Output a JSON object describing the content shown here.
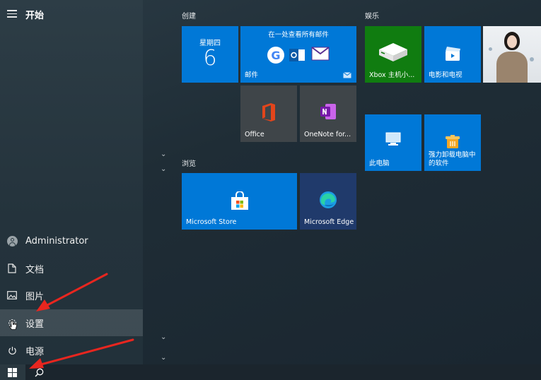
{
  "rail": {
    "title": "开始",
    "items": [
      {
        "label": "Administrator",
        "icon": "user-avatar-icon"
      },
      {
        "label": "文档",
        "icon": "document-icon"
      },
      {
        "label": "图片",
        "icon": "picture-icon"
      },
      {
        "label": "设置",
        "icon": "gear-icon"
      },
      {
        "label": "电源",
        "icon": "power-icon"
      }
    ]
  },
  "groups": {
    "create": "创建",
    "entertainment": "娱乐",
    "browse": "浏览"
  },
  "tiles": {
    "calendar": {
      "day": "星期四",
      "date": "6"
    },
    "mail": {
      "title": "在一处查看所有邮件",
      "label": "邮件"
    },
    "office": {
      "label": "Office"
    },
    "onenote": {
      "label": "OneNote for..."
    },
    "xbox": {
      "label": "Xbox 主机小..."
    },
    "movies": {
      "label": "电影和电视"
    },
    "thispc": {
      "label": "此电脑"
    },
    "uninstall": {
      "label": "强力卸载电脑中的软件",
      "label_line1": "强力卸载电脑中",
      "label_line2": "的软件"
    },
    "store": {
      "label": "Microsoft Store"
    },
    "edge": {
      "label": "Microsoft Edge"
    }
  },
  "colors": {
    "tile_blue": "#0078d7",
    "tile_gray": "#3f4549",
    "tile_green": "#107c10",
    "arrow_red": "#e8261f"
  }
}
